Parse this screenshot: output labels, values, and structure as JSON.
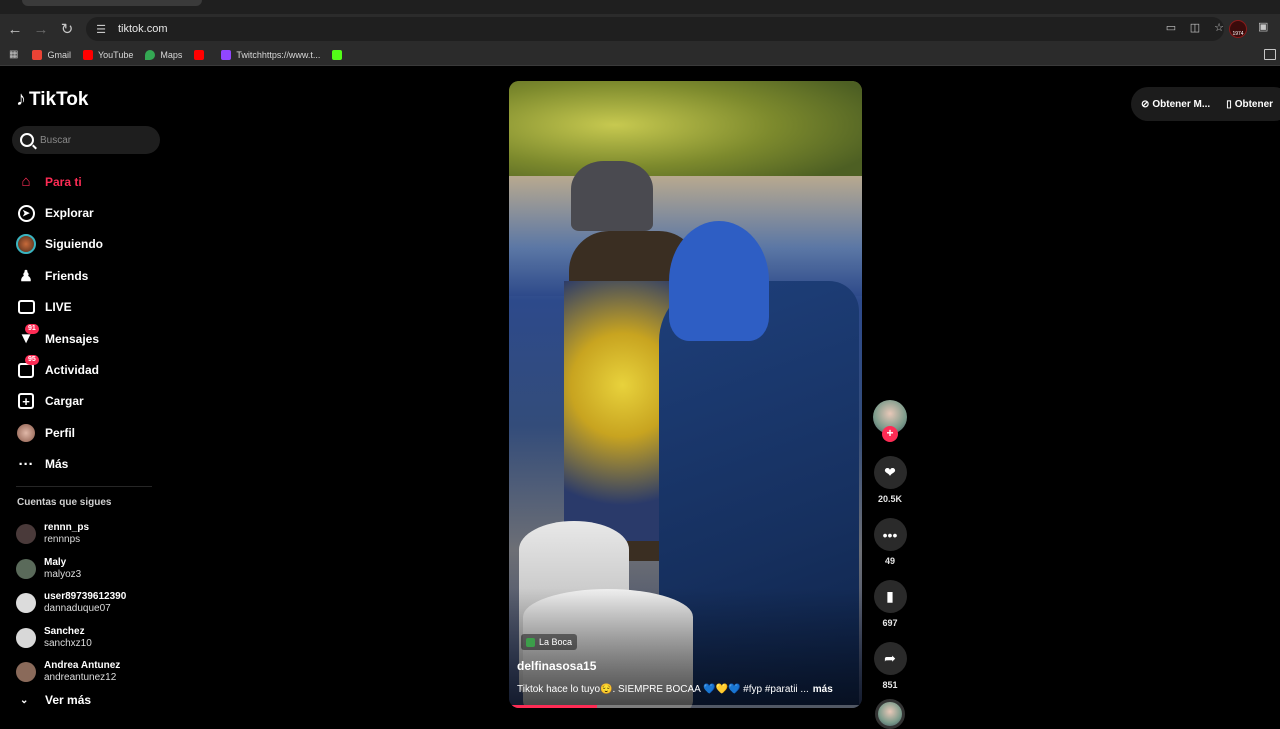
{
  "browser": {
    "url": "tiktok.com",
    "profile_label": "1974",
    "bookmarks": [
      {
        "label": "Gmail",
        "color": "#ea4335"
      },
      {
        "label": "YouTube",
        "color": "#ff0000"
      },
      {
        "label": "Maps",
        "color": "#34a853"
      },
      {
        "label": "",
        "color": "#ff0000"
      },
      {
        "label": "Twitchhttps://www.t...",
        "color": "#9146ff"
      },
      {
        "label": "",
        "color": "#53fc18"
      }
    ]
  },
  "sidebar": {
    "logo": "TikTok",
    "search_placeholder": "Buscar",
    "nav": [
      {
        "label": "Para ti",
        "icon": "home-icon",
        "active": true
      },
      {
        "label": "Explorar",
        "icon": "compass-icon"
      },
      {
        "label": "Siguiendo",
        "icon": "following-avatar-icon"
      },
      {
        "label": "Friends",
        "icon": "friends-icon"
      },
      {
        "label": "LIVE",
        "icon": "live-tv-icon"
      },
      {
        "label": "Mensajes",
        "icon": "messages-icon",
        "badge": "91"
      },
      {
        "label": "Actividad",
        "icon": "activity-icon",
        "badge": "95"
      },
      {
        "label": "Cargar",
        "icon": "upload-plus-icon"
      },
      {
        "label": "Perfil",
        "icon": "profile-avatar-icon"
      },
      {
        "label": "Más",
        "icon": "more-dots-icon"
      }
    ],
    "following_title": "Cuentas que sigues",
    "following": [
      {
        "name": "rennn_ps",
        "handle": "rennnps",
        "color": "#4a3a3a"
      },
      {
        "name": "Maly",
        "handle": "malyoz3",
        "color": "#5a6a5a"
      },
      {
        "name": "user89739612390",
        "handle": "dannaduque07",
        "color": "#dcdcdc"
      },
      {
        "name": "Sanchez",
        "handle": "sanchxz10",
        "color": "#d8d8d8"
      },
      {
        "name": "Andrea Antunez",
        "handle": "andreantunez12",
        "color": "#8a6a5a"
      }
    ],
    "see_more": "Ver más"
  },
  "video": {
    "location": "La Boca",
    "author": "delfinasosa15",
    "caption": "Tiktok hace lo tuyo😌. SIEMPRE BOCAA 💙💛💙 #fyp #paratii ...",
    "more": "más",
    "progress": 0.25
  },
  "actions": {
    "likes": "20.5K",
    "comments": "49",
    "saves": "697",
    "shares": "851"
  },
  "top_right": {
    "get_app": "Obtener M...",
    "get_app2": "Obtener"
  }
}
